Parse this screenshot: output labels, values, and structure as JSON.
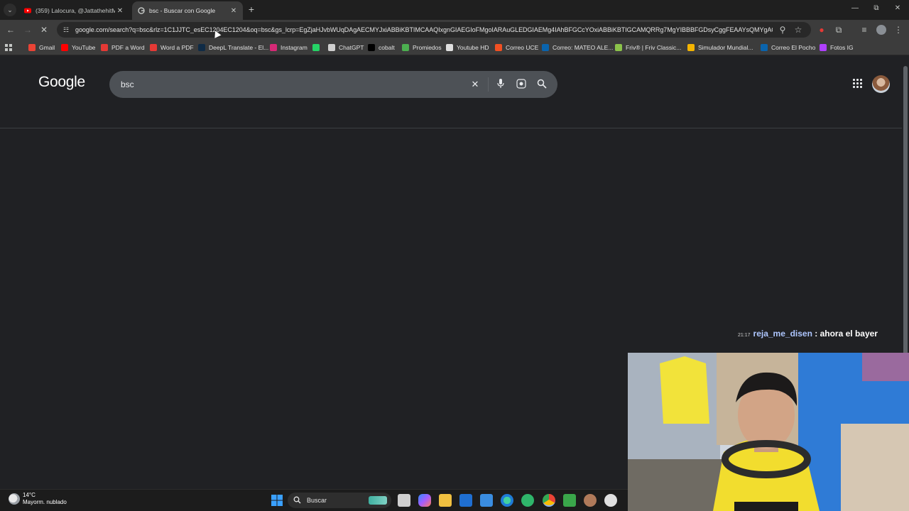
{
  "browser": {
    "tabs": [
      {
        "title": "(359) Lalocura, @JattathehitMa",
        "favicon": "youtube-favicon",
        "active": false,
        "close": "✕"
      },
      {
        "title": "bsc - Buscar con Google",
        "favicon": "google-favicon",
        "active": true,
        "close": "✕"
      }
    ],
    "new_tab": "+",
    "window_controls": {
      "minimize": "—",
      "restore": "⧉",
      "close": "✕"
    },
    "url": "google.com/search?q=bsc&rlz=1C1JJTC_esEC1204EC1204&oq=bsc&gs_lcrp=EgZjaHJvbWUqDAgAECMYJxiABBiKBTIMCAAQIxgnGIAEGIoFMgoIARAuGLEDGIAEMg4IAhBFGCcYOxiABBiKBTIGCAMQRRg7MgYIBBBFGDsyCggFEAAYsQMYgAQy...",
    "bookmarks": [
      {
        "label": "Gmail",
        "icon": "gmail-icon",
        "color": "#ea4335"
      },
      {
        "label": "YouTube",
        "icon": "youtube-icon",
        "color": "#ff0000"
      },
      {
        "label": "PDF a Word",
        "icon": "pdf-icon",
        "color": "#e53935"
      },
      {
        "label": "Word a PDF",
        "icon": "pdf-icon",
        "color": "#e53935"
      },
      {
        "label": "DeepL Translate - El...",
        "icon": "deepl-icon",
        "color": "#0f2b46"
      },
      {
        "label": "Instagram",
        "icon": "instagram-icon",
        "color": "#d62976"
      },
      {
        "label": "",
        "icon": "whatsapp-icon",
        "color": "#25d366"
      },
      {
        "label": "ChatGPT",
        "icon": "chatgpt-icon",
        "color": "#cfcfcf"
      },
      {
        "label": "cobalt",
        "icon": "cobalt-icon",
        "color": "#000000"
      },
      {
        "label": "Promiedos",
        "icon": "promiedos-icon",
        "color": "#4caf50"
      },
      {
        "label": "Youtube HD",
        "icon": "youtube-hd-icon",
        "color": "#e0e0e0"
      },
      {
        "label": "Correo UCE",
        "icon": "office-icon",
        "color": "#f25022"
      },
      {
        "label": "Correo: MATEO ALE...",
        "icon": "outlook-icon",
        "color": "#0a64ad"
      },
      {
        "label": "Friv® | Friv Classic...",
        "icon": "friv-icon",
        "color": "#8bc34a"
      },
      {
        "label": "Simulador Mundial...",
        "icon": "simulator-icon",
        "color": "#f4b400"
      },
      {
        "label": "Correo El Pocho",
        "icon": "outlook-icon",
        "color": "#0a64ad"
      },
      {
        "label": "Fotos IG",
        "icon": "folder-icon",
        "color": "#b040ff"
      }
    ]
  },
  "google": {
    "logo": "Google",
    "query": "bsc"
  },
  "stream": {
    "chat": {
      "time": "21:17",
      "user": "reja_me_disen",
      "message": ": ahora el bayer"
    }
  },
  "taskbar": {
    "temperature": "14°C",
    "condition": "Mayorm. nublado",
    "search_label": "Buscar"
  }
}
